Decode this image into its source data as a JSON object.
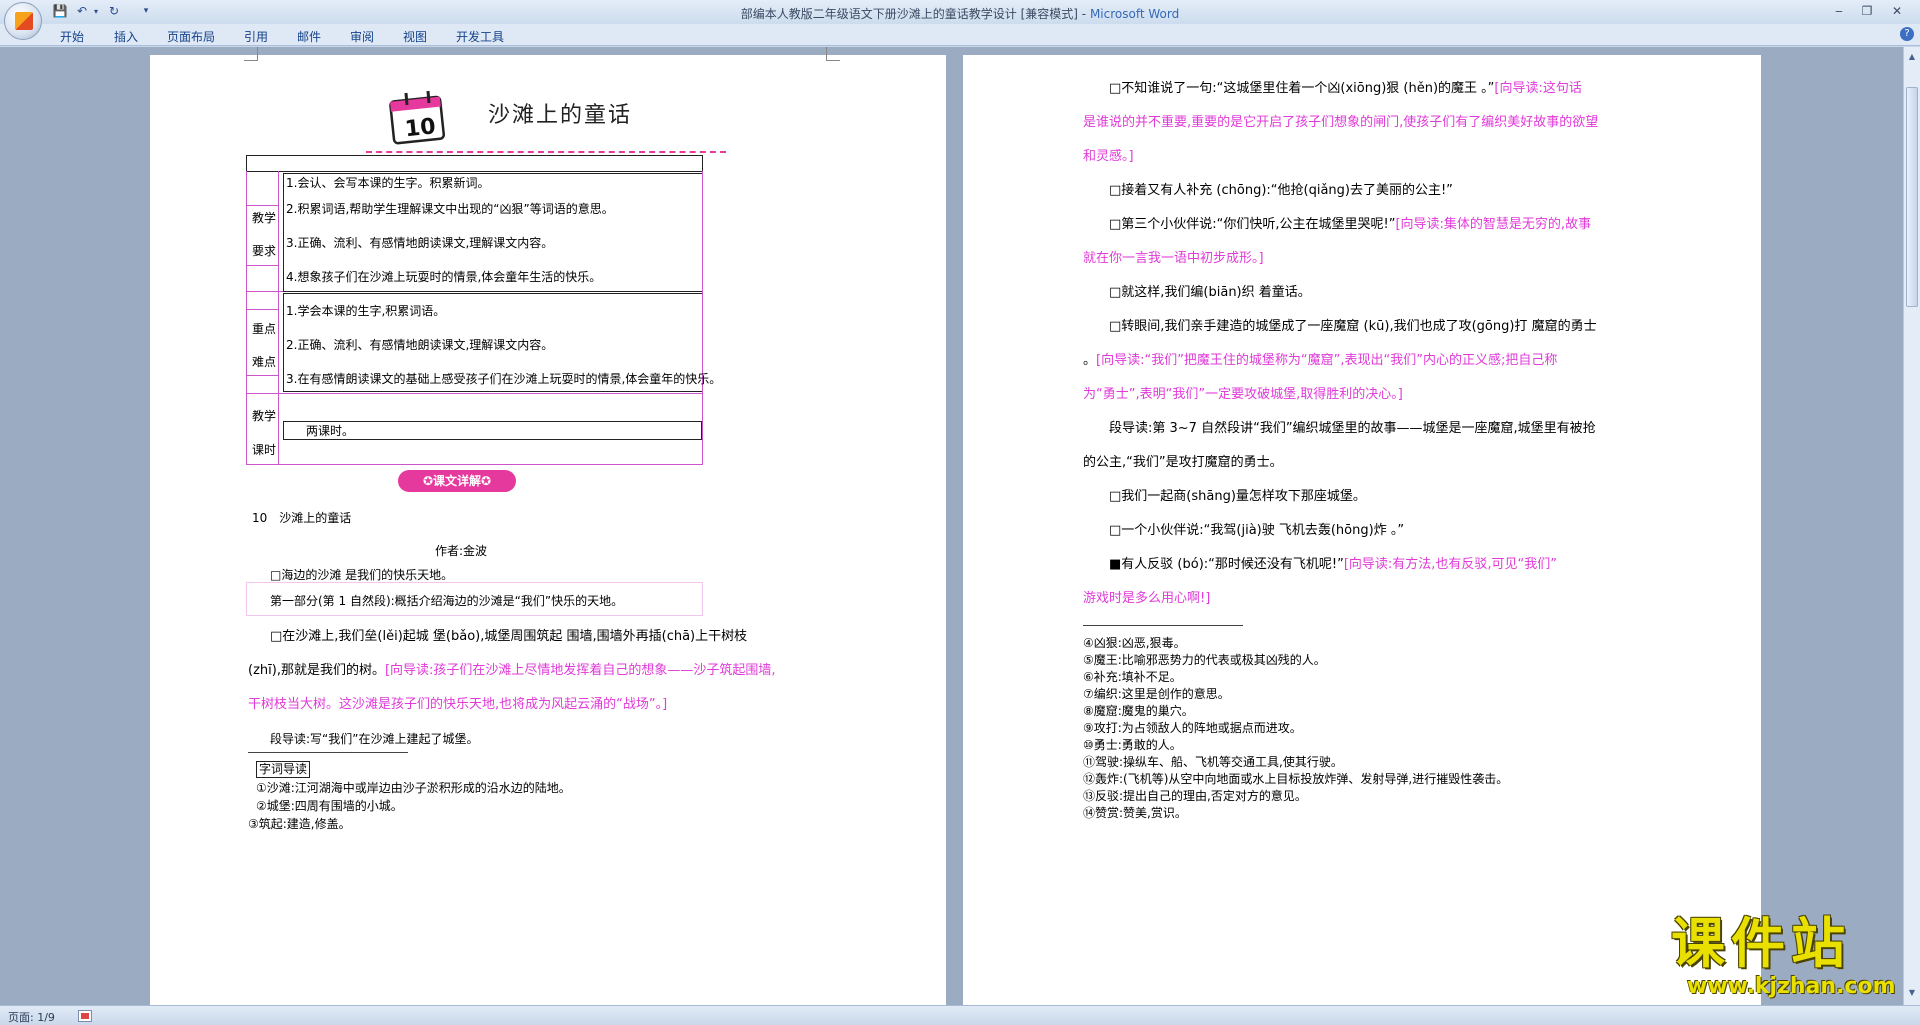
{
  "window": {
    "title_doc": "部编本人教版二年级语文下册沙滩上的童话教学设计 [兼容模式]",
    "title_app": "Microsoft Word",
    "title_sep": " - "
  },
  "ribbon": {
    "tabs": [
      "开始",
      "插入",
      "页面布局",
      "引用",
      "邮件",
      "审阅",
      "视图",
      "开发工具"
    ]
  },
  "status": {
    "page": "页面: 1/9"
  },
  "left": {
    "lesson_number": "10",
    "lesson_title": "沙滩上的童话",
    "table": {
      "row1_label_a": "教学",
      "row1_label_b": "要求",
      "row1_items": [
        "1.会认、会写本课的生字。积累新词。",
        "2.积累词语,帮助学生理解课文中出现的“凶狠”等词语的意思。",
        "3.正确、流利、有感情地朗读课文,理解课文内容。",
        "4.想象孩子们在沙滩上玩耍时的情景,体会童年生活的快乐。"
      ],
      "row2_label_a": "重点",
      "row2_label_b": "难点",
      "row2_items": [
        "1.学会本课的生字,积累词语。",
        "2.正确、流利、有感情地朗读课文,理解课文内容。",
        "3.在有感情朗读课文的基础上感受孩子们在沙滩上玩耍时的情景,体会童年的快乐。"
      ],
      "row3_label_a": "教学",
      "row3_label_b": "课时",
      "row3_value": "两课时。"
    },
    "section_badge": "✪课文详解✪",
    "heading": "10　沙滩上的童话",
    "author": "作者:金波",
    "p1": "□海边的沙滩 是我们的快乐天地。",
    "box_text": "第一部分(第 1 自然段):概括介绍海边的沙滩是“我们”快乐的天地。",
    "p2_l1": "□在沙滩上,我们垒(lěi)起城 堡(bǎo),城堡周围筑起 围墙,围墙外再插(chā)上干树枝",
    "p2_l2a": "(zhī),那就是我们的树。",
    "p2_l2b": "[向导读:孩子们在沙滩上尽情地发挥着自己的想象——沙子筑起围墙,",
    "p2_l3": "干树枝当大树。这沙滩是孩子们的快乐天地,也将成为风起云涌的“战场”。]",
    "p3": "段导读:写“我们”在沙滩上建起了城堡。",
    "notes_title": "字词导读",
    "notes": [
      "①沙滩:江河湖海中或岸边由沙子淤积形成的沿水边的陆地。",
      "②城堡:四周有围墙的小城。",
      "③筑起:建造,修盖。"
    ]
  },
  "right": {
    "r1a": "□不知谁说了一句:“这城堡里住着一个凶(xiōng)狠 (hěn)的魔王 。”",
    "r1b": "[向导读:这句话",
    "r2": "是谁说的并不重要,重要的是它开启了孩子们想象的闸门,使孩子们有了编织美好故事的欲望",
    "r3": "和灵感。]",
    "r4": "□接着又有人补充 (chōng):“他抢(qiǎng)去了美丽的公主!”",
    "r5a": "□第三个小伙伴说:“你们快听,公主在城堡里哭呢!”",
    "r5b": "[向导读:集体的智慧是无穷的,故事",
    "r6": "就在你一言我一语中初步成形。]",
    "r7": "□就这样,我们编(biān)织 着童话。",
    "r8": "□转眼间,我们亲手建造的城堡成了一座魔窟 (kū),我们也成了攻(gōng)打 魔窟的勇士",
    "r9a": "。",
    "r9b": "[向导读:“我们”把魔王住的城堡称为“魔窟”,表现出“我们”内心的正义感;把自己称",
    "r10": "为“勇士”,表明“我们”一定要攻破城堡,取得胜利的决心。]",
    "r11": "段导读:第 3~7 自然段讲“我们”编织城堡里的故事——城堡是一座魔窟,城堡里有被抢",
    "r12": "的公主,“我们”是攻打魔窟的勇士。",
    "r13": "□我们一起商(shāng)量怎样攻下那座城堡。",
    "r14": "□一个小伙伴说:“我驾(jià)驶 飞机去轰(hōng)炸 。”",
    "r15a": "■有人反驳 (bó):“那时候还没有飞机呢!”",
    "r15b": "[向导读:有方法,也有反驳,可见“我们”",
    "r16": "游戏时是多么用心啊!]",
    "notes": [
      "④凶狠:凶恶,狠毒。",
      "⑤魔王:比喻邪恶势力的代表或极其凶残的人。",
      "⑥补充:填补不足。",
      "⑦编织:这里是创作的意思。",
      "⑧魔窟:魔鬼的巢穴。",
      "⑨攻打:为占领敌人的阵地或据点而进攻。",
      "⑩勇士:勇敢的人。",
      "⑪驾驶:操纵车、船、飞机等交通工具,使其行驶。",
      "⑫轰炸:(飞机等)从空中向地面或水上目标投放炸弹、发射导弹,进行摧毁性袭击。",
      "⑬反驳:提出自己的理由,否定对方的意见。",
      "⑭赞赏:赞美,赏识。"
    ]
  },
  "watermark": {
    "top": "课件站",
    "bottom": "www.kjzhan.com"
  },
  "colors": {
    "accent_pink": "#e03ad8",
    "table_border": "#cc55cc",
    "ribbon_text": "#15428b"
  }
}
